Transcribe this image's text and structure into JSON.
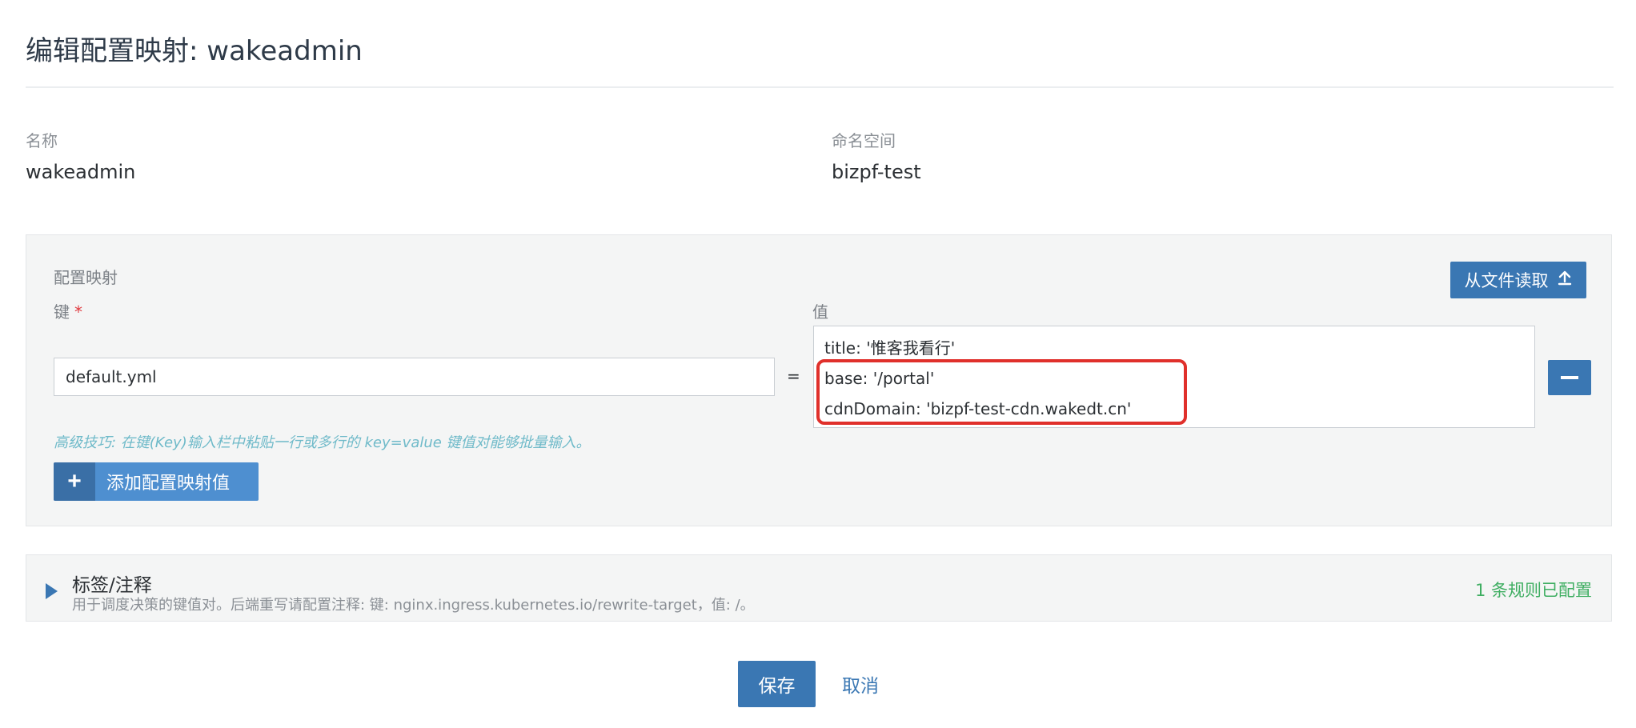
{
  "page": {
    "title": "编辑配置映射: wakeadmin"
  },
  "meta": {
    "name_label": "名称",
    "name_value": "wakeadmin",
    "namespace_label": "命名空间",
    "namespace_value": "bizpf-test"
  },
  "config_map": {
    "heading": "配置映射",
    "read_file_label": "从文件读取",
    "key_label": "键",
    "required_mark": "*",
    "value_label": "值",
    "key_value": "default.yml",
    "equals": "=",
    "value_lines": [
      "title: '惟客我看行'",
      "base: '/portal'",
      "cdnDomain: 'bizpf-test-cdn.wakedt.cn'"
    ],
    "tip": "高级技巧: 在键(Key)输入栏中粘贴一行或多行的 key=value 键值对能够批量输入。",
    "add_button_plus": "+",
    "add_button_label": "添加配置映射值"
  },
  "labels_section": {
    "title": "标签/注释",
    "description": "用于调度决策的键值对。后端重写请配置注释: 键: nginx.ingress.kubernetes.io/rewrite-target，值: /。",
    "rules_count": "1 条规则已配置"
  },
  "actions": {
    "save_label": "保存",
    "cancel_label": "取消"
  },
  "colors": {
    "primary": "#3a77b3",
    "highlight": "#e0302b",
    "success": "#3fae62",
    "tip": "#6fbac9"
  },
  "icons": {
    "upload": "upload-icon",
    "minus": "minus-icon",
    "plus": "plus-icon",
    "expand": "triangle-right-icon"
  }
}
